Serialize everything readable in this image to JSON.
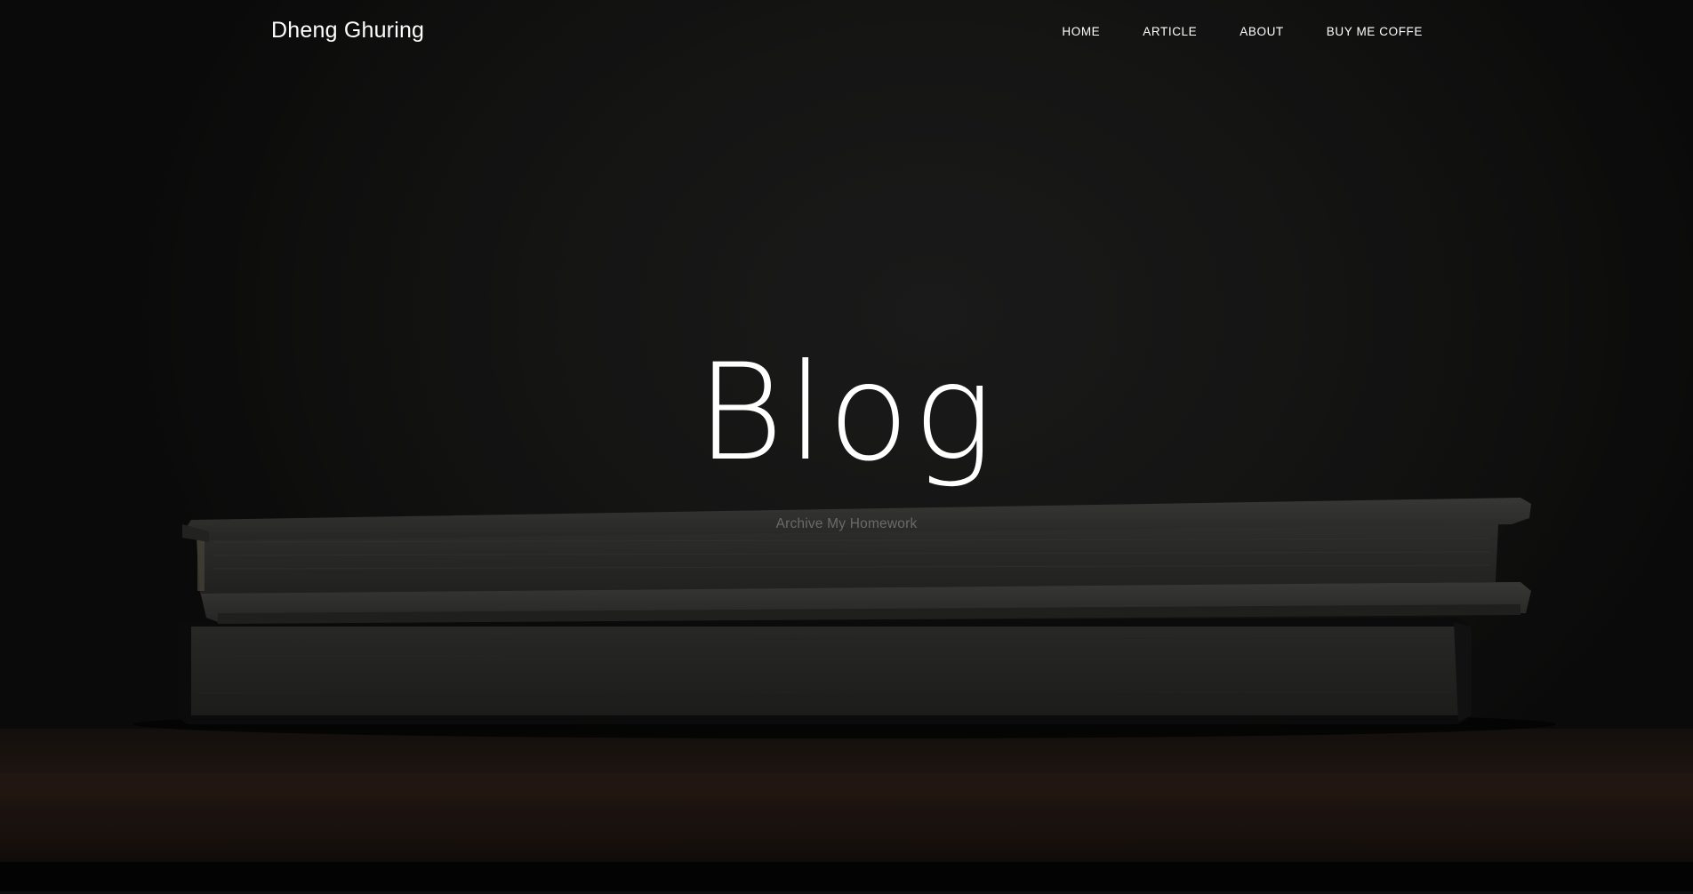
{
  "brand": {
    "name": "Dheng Ghuring"
  },
  "nav": {
    "items": [
      {
        "label": "HOME"
      },
      {
        "label": "ARTICLE"
      },
      {
        "label": "ABOUT"
      },
      {
        "label": "BUY ME COFFE"
      }
    ]
  },
  "hero": {
    "title": "Blog",
    "subtitle": "Archive My Homework",
    "background_image": "stacked-books-on-wooden-table"
  },
  "colors": {
    "background": "#1c1c1b",
    "text": "#ffffff",
    "subtitle": "#6a6a6a"
  }
}
